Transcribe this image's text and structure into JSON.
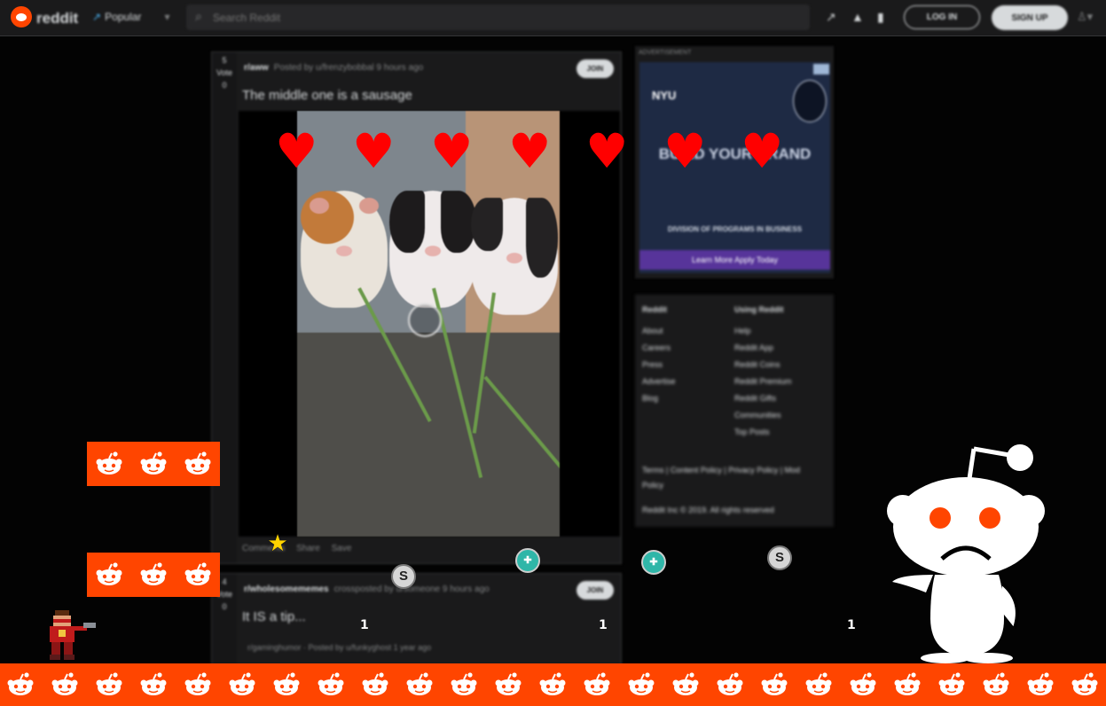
{
  "header": {
    "logo_text": "reddit",
    "feed_label": "Popular",
    "search_placeholder": "Search Reddit",
    "login_label": "LOG IN",
    "signup_label": "SIGN UP"
  },
  "posts": [
    {
      "votes": "5",
      "vote_sub": "Vote",
      "vote_down": "0",
      "subreddit": "r/aww",
      "posted_by": "Posted by u/frenzybobbal 9 hours ago",
      "join_label": "JOIN",
      "title": "The middle one is a sausage",
      "actions": [
        "Comments",
        "Share",
        "Save"
      ]
    },
    {
      "votes": "4",
      "vote_sub": "Vote",
      "vote_down": "0",
      "subreddit": "r/wholesomememes",
      "posted_by": "crossposted by u/someone 9 hours ago",
      "join_label": "JOIN",
      "title": "It IS a tip...",
      "comment": "r/gaminghumor · Posted by u/funkyghost 1 year ago"
    }
  ],
  "ad": {
    "label": "ADVERTISEMENT",
    "brand": "NYU",
    "headline": "BUILD YOUR BRAND",
    "subline": "DIVISION OF PROGRAMS IN BUSINESS",
    "cta": "Learn More Apply Today"
  },
  "sidebar": {
    "col1": [
      "Reddit",
      "About",
      "Careers",
      "Press",
      "Advertise",
      "Blog"
    ],
    "col2": [
      "Using Reddit",
      "Help",
      "Reddit App",
      "Reddit Coins",
      "Reddit Premium",
      "Reddit Gifts",
      "Communities",
      "Top Posts"
    ],
    "legal": "Terms | Content Policy | Privacy Policy | Mod Policy",
    "copyright": "Reddit Inc © 2019. All rights reserved"
  },
  "game": {
    "heart_glyph": "♥",
    "star_glyph": "★",
    "coin_silver_glyph": "S",
    "coin_teal_glyph": "✚",
    "counters": [
      "1",
      "1",
      "1"
    ],
    "colors": {
      "ground": "#ff4500",
      "heart": "#ff0000",
      "alien": "#ffffff"
    }
  }
}
